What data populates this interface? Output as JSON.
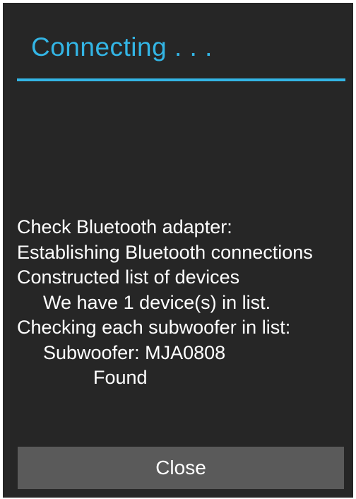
{
  "dialog": {
    "title": "Connecting . . .",
    "accent_color": "#33b5e5",
    "log_lines": [
      "Check Bluetooth adapter:",
      "Establishing Bluetooth connections",
      "Constructed list of devices",
      "We have 1 device(s) in list.",
      "Checking each subwoofer in list:",
      "Subwoofer: MJA0808",
      "Found"
    ],
    "close_label": "Close"
  }
}
